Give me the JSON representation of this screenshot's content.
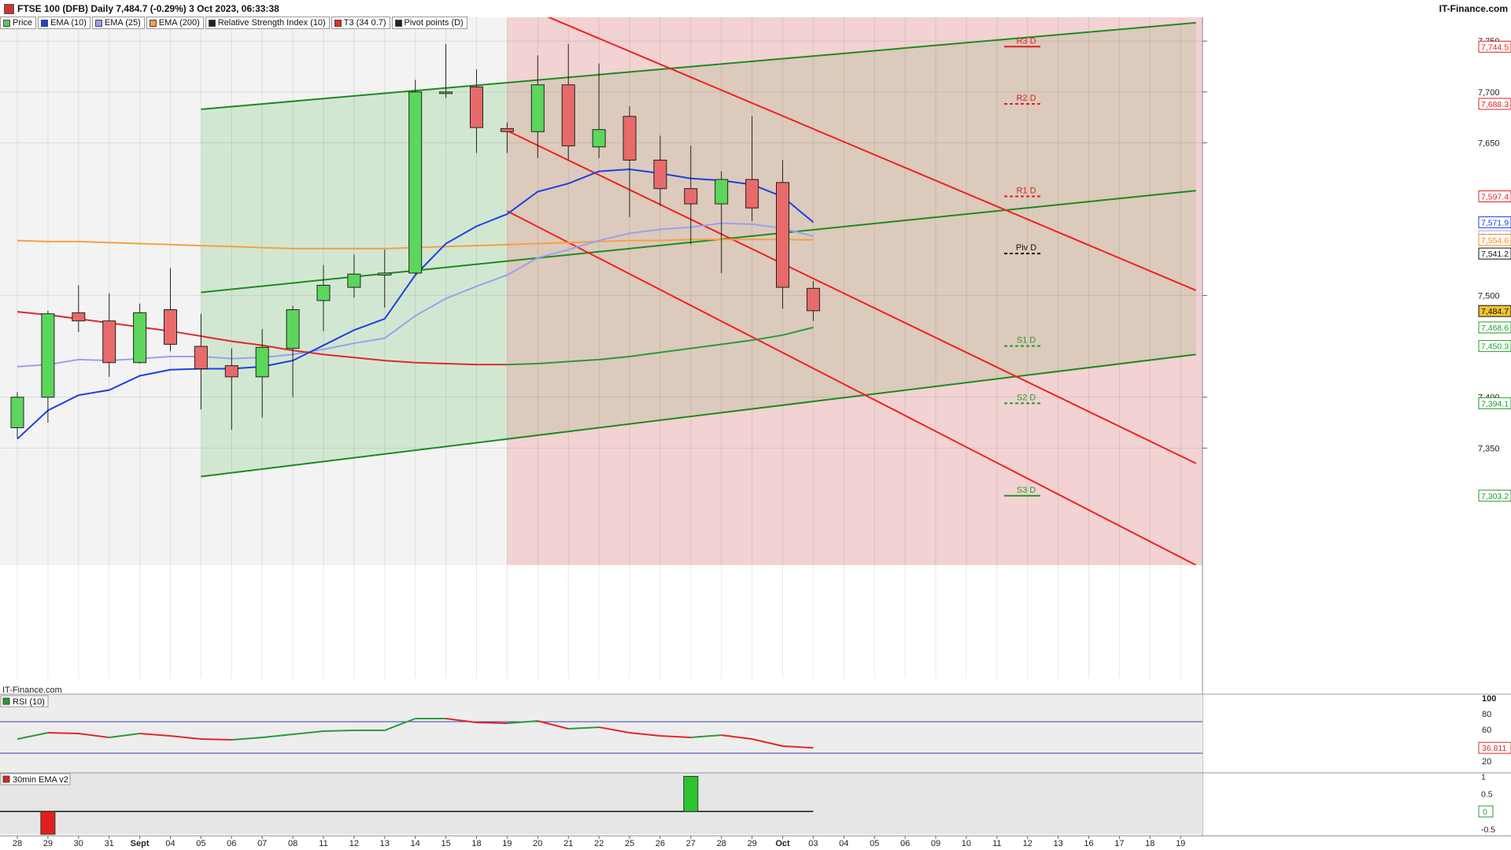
{
  "header": {
    "title": "FTSE 100 (DFB) Daily 7,484.7 (-0.29%) 3 Oct 2023, 06:33:38",
    "site": "IT-Finance.com"
  },
  "legend": [
    {
      "label": "Price",
      "color": "#5cc85c"
    },
    {
      "label": "EMA (10)",
      "color": "#1f3fdf"
    },
    {
      "label": "EMA (25)",
      "color": "#9aa0f0"
    },
    {
      "label": "EMA (200)",
      "color": "#f4a040"
    },
    {
      "label": "Relative Strength Index (10)",
      "color": "#222222"
    },
    {
      "label": "T3 (34 0.7)",
      "color": "#dd3322"
    },
    {
      "label": "Pivot points (D)",
      "color": "#222222"
    }
  ],
  "watermark": "IT-Finance.com",
  "panels": {
    "rsi_label": "RSI (10)",
    "ema_label": "30min EMA v2"
  },
  "colors": {
    "bull": "#5cd65c",
    "bear": "#e86a6a",
    "ema10": "#1f3fdf",
    "ema25": "#9aa0f0",
    "ema200": "#f4a040",
    "t3": "#e02828",
    "t3_up": "#2a9a3a",
    "channel_green": "#1e8a1e",
    "channel_red": "#ee2222"
  },
  "chart_data": {
    "type": "candlestick",
    "title": "FTSE 100 (DFB) Daily 7,484.7 (-0.29%) 3 Oct 2023, 06:33:38",
    "ylim": [
      7235,
      7778
    ],
    "y_ticks": [
      {
        "v": 7350,
        "label": "7,350"
      },
      {
        "v": 7400,
        "label": "7,400"
      },
      {
        "v": 7500,
        "label": "7,500"
      },
      {
        "v": 7650,
        "label": "7,650"
      },
      {
        "v": 7700,
        "label": "7,700"
      },
      {
        "v": 7750,
        "label": "7,750"
      }
    ],
    "x_labels": [
      {
        "i": 0,
        "label": "28"
      },
      {
        "i": 1,
        "label": "29"
      },
      {
        "i": 2,
        "label": "30"
      },
      {
        "i": 3,
        "label": "31"
      },
      {
        "i": 4,
        "label": "Sept",
        "bold": true
      },
      {
        "i": 5,
        "label": "04"
      },
      {
        "i": 6,
        "label": "05"
      },
      {
        "i": 7,
        "label": "06"
      },
      {
        "i": 8,
        "label": "07"
      },
      {
        "i": 9,
        "label": "08"
      },
      {
        "i": 10,
        "label": "11"
      },
      {
        "i": 11,
        "label": "12"
      },
      {
        "i": 12,
        "label": "13"
      },
      {
        "i": 13,
        "label": "14"
      },
      {
        "i": 14,
        "label": "15"
      },
      {
        "i": 15,
        "label": "18"
      },
      {
        "i": 16,
        "label": "19"
      },
      {
        "i": 17,
        "label": "20"
      },
      {
        "i": 18,
        "label": "21"
      },
      {
        "i": 19,
        "label": "22"
      },
      {
        "i": 20,
        "label": "25"
      },
      {
        "i": 21,
        "label": "26"
      },
      {
        "i": 22,
        "label": "27"
      },
      {
        "i": 23,
        "label": "28"
      },
      {
        "i": 24,
        "label": "29"
      },
      {
        "i": 25,
        "label": "Oct",
        "bold": true
      },
      {
        "i": 26,
        "label": "03"
      },
      {
        "i": 27,
        "label": "04"
      },
      {
        "i": 28,
        "label": "05"
      },
      {
        "i": 29,
        "label": "06"
      },
      {
        "i": 30,
        "label": "09"
      },
      {
        "i": 31,
        "label": "10"
      },
      {
        "i": 32,
        "label": "11"
      },
      {
        "i": 33,
        "label": "12"
      },
      {
        "i": 34,
        "label": "13"
      },
      {
        "i": 35,
        "label": "16"
      },
      {
        "i": 36,
        "label": "17"
      },
      {
        "i": 37,
        "label": "18"
      },
      {
        "i": 38,
        "label": "19"
      }
    ],
    "candles": [
      {
        "i": 0,
        "o": 7370,
        "h": 7405,
        "l": 7360,
        "c": 7400
      },
      {
        "i": 1,
        "o": 7400,
        "h": 7485,
        "l": 7375,
        "c": 7482
      },
      {
        "i": 2,
        "o": 7483,
        "h": 7510,
        "l": 7464,
        "c": 7475
      },
      {
        "i": 3,
        "o": 7475,
        "h": 7502,
        "l": 7420,
        "c": 7434
      },
      {
        "i": 4,
        "o": 7434,
        "h": 7492,
        "l": 7433,
        "c": 7483
      },
      {
        "i": 5,
        "o": 7486,
        "h": 7527,
        "l": 7445,
        "c": 7452
      },
      {
        "i": 6,
        "o": 7450,
        "h": 7482,
        "l": 7388,
        "c": 7428
      },
      {
        "i": 7,
        "o": 7431,
        "h": 7448,
        "l": 7368,
        "c": 7420
      },
      {
        "i": 8,
        "o": 7420,
        "h": 7467,
        "l": 7380,
        "c": 7449
      },
      {
        "i": 9,
        "o": 7448,
        "h": 7490,
        "l": 7400,
        "c": 7486
      },
      {
        "i": 10,
        "o": 7495,
        "h": 7530,
        "l": 7465,
        "c": 7510
      },
      {
        "i": 11,
        "o": 7508,
        "h": 7540,
        "l": 7498,
        "c": 7521
      },
      {
        "i": 12,
        "o": 7520,
        "h": 7545,
        "l": 7488,
        "c": 7522
      },
      {
        "i": 13,
        "o": 7522,
        "h": 7712,
        "l": 7521,
        "c": 7700
      },
      {
        "i": 14,
        "o": 7700,
        "h": 7747,
        "l": 7694,
        "c": 7700
      },
      {
        "i": 15,
        "o": 7705,
        "h": 7722,
        "l": 7640,
        "c": 7665
      },
      {
        "i": 16,
        "o": 7664,
        "h": 7670,
        "l": 7640,
        "c": 7661
      },
      {
        "i": 17,
        "o": 7661,
        "h": 7736,
        "l": 7635,
        "c": 7707
      },
      {
        "i": 18,
        "o": 7707,
        "h": 7747,
        "l": 7633,
        "c": 7647
      },
      {
        "i": 19,
        "o": 7646,
        "h": 7728,
        "l": 7635,
        "c": 7663
      },
      {
        "i": 20,
        "o": 7676,
        "h": 7686,
        "l": 7577,
        "c": 7633
      },
      {
        "i": 21,
        "o": 7633,
        "h": 7657,
        "l": 7588,
        "c": 7605
      },
      {
        "i": 22,
        "o": 7605,
        "h": 7647,
        "l": 7550,
        "c": 7590
      },
      {
        "i": 23,
        "o": 7590,
        "h": 7622,
        "l": 7522,
        "c": 7614
      },
      {
        "i": 24,
        "o": 7614,
        "h": 7676,
        "l": 7573,
        "c": 7586
      },
      {
        "i": 25,
        "o": 7611,
        "h": 7633,
        "l": 7487,
        "c": 7508
      },
      {
        "i": 26,
        "o": 7507,
        "h": 7514,
        "l": 7475,
        "c": 7485
      }
    ],
    "ema10": [
      {
        "i": 0,
        "v": 7359
      },
      {
        "i": 1,
        "v": 7387
      },
      {
        "i": 2,
        "v": 7402
      },
      {
        "i": 3,
        "v": 7407
      },
      {
        "i": 4,
        "v": 7421
      },
      {
        "i": 5,
        "v": 7427
      },
      {
        "i": 6,
        "v": 7428
      },
      {
        "i": 7,
        "v": 7428
      },
      {
        "i": 8,
        "v": 7430
      },
      {
        "i": 9,
        "v": 7436
      },
      {
        "i": 10,
        "v": 7451
      },
      {
        "i": 11,
        "v": 7466
      },
      {
        "i": 12,
        "v": 7477
      },
      {
        "i": 13,
        "v": 7520
      },
      {
        "i": 14,
        "v": 7551
      },
      {
        "i": 15,
        "v": 7568
      },
      {
        "i": 16,
        "v": 7580
      },
      {
        "i": 17,
        "v": 7602
      },
      {
        "i": 18,
        "v": 7610
      },
      {
        "i": 19,
        "v": 7622
      },
      {
        "i": 20,
        "v": 7624
      },
      {
        "i": 21,
        "v": 7620
      },
      {
        "i": 22,
        "v": 7615
      },
      {
        "i": 23,
        "v": 7613
      },
      {
        "i": 24,
        "v": 7609
      },
      {
        "i": 25,
        "v": 7597
      },
      {
        "i": 26,
        "v": 7571.9
      }
    ],
    "ema25": [
      {
        "i": 0,
        "v": 7430
      },
      {
        "i": 1,
        "v": 7432
      },
      {
        "i": 2,
        "v": 7437
      },
      {
        "i": 3,
        "v": 7436
      },
      {
        "i": 4,
        "v": 7438
      },
      {
        "i": 5,
        "v": 7440
      },
      {
        "i": 6,
        "v": 7440
      },
      {
        "i": 7,
        "v": 7438
      },
      {
        "i": 8,
        "v": 7439
      },
      {
        "i": 9,
        "v": 7442
      },
      {
        "i": 10,
        "v": 7447
      },
      {
        "i": 11,
        "v": 7453
      },
      {
        "i": 12,
        "v": 7458
      },
      {
        "i": 13,
        "v": 7480
      },
      {
        "i": 14,
        "v": 7497
      },
      {
        "i": 15,
        "v": 7509
      },
      {
        "i": 16,
        "v": 7520
      },
      {
        "i": 17,
        "v": 7537
      },
      {
        "i": 18,
        "v": 7545
      },
      {
        "i": 19,
        "v": 7554
      },
      {
        "i": 20,
        "v": 7561
      },
      {
        "i": 21,
        "v": 7565
      },
      {
        "i": 22,
        "v": 7567
      },
      {
        "i": 23,
        "v": 7571
      },
      {
        "i": 24,
        "v": 7570
      },
      {
        "i": 25,
        "v": 7566
      },
      {
        "i": 26,
        "v": 7558.2
      }
    ],
    "ema200": [
      {
        "i": 0,
        "v": 7554
      },
      {
        "i": 1,
        "v": 7553
      },
      {
        "i": 2,
        "v": 7553
      },
      {
        "i": 3,
        "v": 7552
      },
      {
        "i": 4,
        "v": 7551
      },
      {
        "i": 5,
        "v": 7550
      },
      {
        "i": 6,
        "v": 7549
      },
      {
        "i": 7,
        "v": 7548
      },
      {
        "i": 8,
        "v": 7547
      },
      {
        "i": 9,
        "v": 7546
      },
      {
        "i": 10,
        "v": 7546
      },
      {
        "i": 11,
        "v": 7546
      },
      {
        "i": 12,
        "v": 7546
      },
      {
        "i": 13,
        "v": 7547
      },
      {
        "i": 14,
        "v": 7548
      },
      {
        "i": 15,
        "v": 7549
      },
      {
        "i": 16,
        "v": 7550
      },
      {
        "i": 17,
        "v": 7551
      },
      {
        "i": 18,
        "v": 7552
      },
      {
        "i": 19,
        "v": 7553
      },
      {
        "i": 20,
        "v": 7554
      },
      {
        "i": 21,
        "v": 7554
      },
      {
        "i": 22,
        "v": 7555
      },
      {
        "i": 23,
        "v": 7555
      },
      {
        "i": 24,
        "v": 7555
      },
      {
        "i": 25,
        "v": 7555
      },
      {
        "i": 26,
        "v": 7554.6
      }
    ],
    "t3": [
      {
        "i": 0,
        "v": 7484
      },
      {
        "i": 1,
        "v": 7481
      },
      {
        "i": 2,
        "v": 7477
      },
      {
        "i": 3,
        "v": 7473
      },
      {
        "i": 4,
        "v": 7469
      },
      {
        "i": 5,
        "v": 7465
      },
      {
        "i": 6,
        "v": 7460
      },
      {
        "i": 7,
        "v": 7455
      },
      {
        "i": 8,
        "v": 7451
      },
      {
        "i": 9,
        "v": 7446
      },
      {
        "i": 10,
        "v": 7442
      },
      {
        "i": 11,
        "v": 7439
      },
      {
        "i": 12,
        "v": 7436
      },
      {
        "i": 13,
        "v": 7434
      },
      {
        "i": 14,
        "v": 7433
      },
      {
        "i": 15,
        "v": 7432
      },
      {
        "i": 16,
        "v": 7432
      },
      {
        "i": 17,
        "v": 7433
      },
      {
        "i": 18,
        "v": 7435
      },
      {
        "i": 19,
        "v": 7437
      },
      {
        "i": 20,
        "v": 7440
      },
      {
        "i": 21,
        "v": 7444
      },
      {
        "i": 22,
        "v": 7448
      },
      {
        "i": 23,
        "v": 7452
      },
      {
        "i": 24,
        "v": 7456
      },
      {
        "i": 25,
        "v": 7461
      },
      {
        "i": 26,
        "v": 7468.6
      }
    ],
    "t3_turn_index": 16,
    "channels": {
      "green_upper": {
        "i1": 6,
        "v1": 7683,
        "i2": 38.5,
        "v2": 7768
      },
      "green_mid": {
        "i1": 6,
        "v1": 7503,
        "i2": 38.5,
        "v2": 7603
      },
      "green_lower": {
        "i1": 6,
        "v1": 7322,
        "i2": 38.5,
        "v2": 7442
      },
      "red_upper": {
        "i1": 17,
        "v1": 7778,
        "i2": 38.5,
        "v2": 7505
      },
      "red_mid": {
        "i1": 16,
        "v1": 7662,
        "i2": 38.5,
        "v2": 7335
      },
      "red_lower": {
        "i1": 16,
        "v1": 7583,
        "i2": 38.5,
        "v2": 7235
      }
    },
    "pivots": [
      {
        "label": "R3 D",
        "v": 7744.5,
        "color": "#dd2222",
        "dash": false
      },
      {
        "label": "R2 D",
        "v": 7688.3,
        "color": "#dd2222",
        "dash": true
      },
      {
        "label": "R1 D",
        "v": 7597.4,
        "color": "#dd2222",
        "dash": true
      },
      {
        "label": "Piv D",
        "v": 7541.2,
        "color": "#111111",
        "dash": true
      },
      {
        "label": "S1 D",
        "v": 7450.3,
        "color": "#22992a",
        "dash": true
      },
      {
        "label": "S2 D",
        "v": 7394.1,
        "color": "#22992a",
        "dash": true
      },
      {
        "label": "S3 D",
        "v": 7303.2,
        "color": "#22992a",
        "dash": false
      }
    ],
    "price_tags": [
      {
        "label": "7,744.5",
        "v": 7744.5,
        "color": "#dd2222",
        "bg": "#ffffff"
      },
      {
        "label": "7,688.3",
        "v": 7688.3,
        "color": "#dd2222",
        "bg": "#ffffff"
      },
      {
        "label": "7,597.4",
        "v": 7597.4,
        "color": "#dd2222",
        "bg": "#ffffff"
      },
      {
        "label": "7,571.9",
        "v": 7571.9,
        "color": "#1f3fdf",
        "bg": "#ffffff"
      },
      {
        "label": "7,558.2",
        "v": 7558.2,
        "color": "#9aa0f0",
        "bg": "#ffffff"
      },
      {
        "label": "7,554.6",
        "v": 7554.6,
        "color": "#f08a20",
        "bg": "#ffffff"
      },
      {
        "label": "7,541.2",
        "v": 7541.2,
        "color": "#111111",
        "bg": "#ffffff"
      },
      {
        "label": "7,484.7",
        "v": 7484.7,
        "color": "#111111",
        "bg": "#f2c233"
      },
      {
        "label": "7,468.6",
        "v": 7468.6,
        "color": "#22992a",
        "bg": "#ffffff"
      },
      {
        "label": "7,450.3",
        "v": 7450.3,
        "color": "#22992a",
        "bg": "#ffffff"
      },
      {
        "label": "7,394.1",
        "v": 7394.1,
        "color": "#22992a",
        "bg": "#ffffff"
      },
      {
        "label": "7,303.2",
        "v": 7303.2,
        "color": "#22992a",
        "bg": "#ffffff"
      }
    ],
    "rsi": {
      "ylim": [
        0,
        100
      ],
      "ticks": [
        {
          "v": 100,
          "label": "100",
          "bold": true
        },
        {
          "v": 80,
          "label": "80"
        },
        {
          "v": 60,
          "label": "60"
        },
        {
          "v": 20,
          "label": "20"
        }
      ],
      "bands": [
        70,
        30
      ],
      "last_label": "36.811",
      "values": [
        {
          "i": 0,
          "v": 48
        },
        {
          "i": 1,
          "v": 56
        },
        {
          "i": 2,
          "v": 55
        },
        {
          "i": 3,
          "v": 50
        },
        {
          "i": 4,
          "v": 55
        },
        {
          "i": 5,
          "v": 52
        },
        {
          "i": 6,
          "v": 48
        },
        {
          "i": 7,
          "v": 47
        },
        {
          "i": 8,
          "v": 50
        },
        {
          "i": 9,
          "v": 54
        },
        {
          "i": 10,
          "v": 58
        },
        {
          "i": 11,
          "v": 59
        },
        {
          "i": 12,
          "v": 59
        },
        {
          "i": 13,
          "v": 74
        },
        {
          "i": 14,
          "v": 74
        },
        {
          "i": 15,
          "v": 69
        },
        {
          "i": 16,
          "v": 68
        },
        {
          "i": 17,
          "v": 71
        },
        {
          "i": 18,
          "v": 61
        },
        {
          "i": 19,
          "v": 63
        },
        {
          "i": 20,
          "v": 56
        },
        {
          "i": 21,
          "v": 52
        },
        {
          "i": 22,
          "v": 50
        },
        {
          "i": 23,
          "v": 53
        },
        {
          "i": 24,
          "v": 48
        },
        {
          "i": 25,
          "v": 39
        },
        {
          "i": 26,
          "v": 36.811
        }
      ]
    },
    "ema_v2": {
      "ylim": [
        -0.65,
        1.1
      ],
      "ticks": [
        {
          "v": 1,
          "label": "1"
        },
        {
          "v": 0.5,
          "label": "0.5"
        },
        {
          "v": 0,
          "label": "0"
        },
        {
          "v": -0.5,
          "label": "-0.5"
        }
      ],
      "last_label": "0",
      "bars": [
        {
          "i": 1,
          "v": -1,
          "color": "#e02020"
        },
        {
          "i": 22,
          "v": 1,
          "color": "#2ec42e"
        }
      ]
    }
  }
}
